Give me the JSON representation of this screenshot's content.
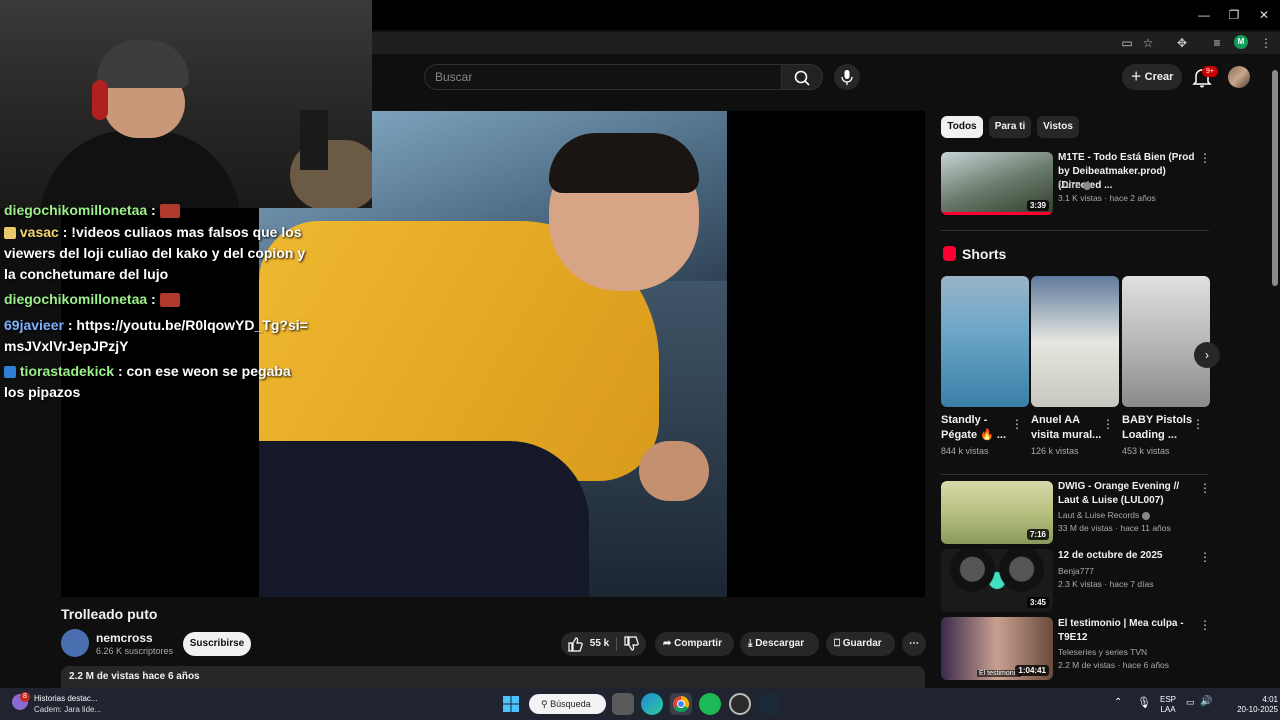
{
  "browser": {
    "window_controls": [
      "—",
      "❐",
      "✕"
    ],
    "omnibox_icons": [
      "cast-icon",
      "star-icon",
      "extensions-icon",
      "media-icon",
      "profile-icon",
      "menu-icon"
    ],
    "profile_initial": "M"
  },
  "header": {
    "search_placeholder": "Buscar",
    "create_label": "Crear",
    "notifications_badge": "9+"
  },
  "chat": [
    {
      "user": "diegochikomillonetaa",
      "sep": " :",
      "text": "",
      "emote": true,
      "user_class": "u-green"
    },
    {
      "user": "vasac",
      "sep": " :",
      "text": " !videos culiaos mas falsos que los viewers del loji culiao del kako y del copion y la conchetumare del lujo",
      "emote": false,
      "user_class": "u-yellow"
    },
    {
      "user": "diegochikomillonetaa",
      "sep": " :",
      "text": "",
      "emote": true,
      "user_class": "u-green"
    },
    {
      "user": "69javieer",
      "sep": " :",
      "text": " https://youtu.be/R0lqowYD_Tg?si=msJVxlVrJepJPzjY",
      "emote": false,
      "user_class": "u-blue"
    },
    {
      "user": "tiorastadekick",
      "sep": " :",
      "text": " con ese weon se pegaba los pipazos",
      "emote": false,
      "user_class": "u-green"
    }
  ],
  "video": {
    "title": "Trolleado puto",
    "channel": "nemcross",
    "subscribers": "6.26 K suscriptores",
    "subscribe_label": "Suscribirse",
    "likes": "55 k",
    "share_label": "Compartir",
    "download_label": "Descargar",
    "save_label": "Guardar",
    "description_meta": "2.2 M de vistas  hace 6 años"
  },
  "sidebar": {
    "chips": [
      "Todos",
      "Para ti",
      "Vistos"
    ],
    "related_top": {
      "title": "M1TE - Todo Está Bien (Prod by Deibeatmaker.prod) (Directed ...",
      "channel": "M1TE",
      "meta": "3.1 K vistas · hace 2 años",
      "duration": "3:39"
    },
    "shorts_heading": "Shorts",
    "shorts": [
      {
        "title": "Standly - Pégate 🔥 ...",
        "views": "844 k vistas"
      },
      {
        "title": "Anuel AA visita mural...",
        "views": "126 k vistas"
      },
      {
        "title": "BABY Pistols Loading ...",
        "views": "453 k vistas"
      }
    ],
    "related": [
      {
        "title": "DWIG - Orange Evening // Laut & Luise (LUL007)",
        "channel": "Laut & Luise Records",
        "meta": "33 M de vistas · hace 11 años",
        "duration": "7:16"
      },
      {
        "title": "12 de octubre de 2025",
        "channel": "Benja777",
        "meta": "2.3 K vistas · hace 7 días",
        "duration": "3:45"
      },
      {
        "title": "El testimonio | Mea culpa - T9E12",
        "channel": "Teleseries y series TVN",
        "meta": "2.2 M de vistas · hace 6 años",
        "duration": "1:04:41",
        "overlay": "El testimonio"
      }
    ]
  },
  "taskbar": {
    "news_title": "Historias destac...",
    "news_sub": "Cadem: Jara lide...",
    "news_badge": "8",
    "search_label": "Búsqueda",
    "lang": "ESP",
    "layout": "LAA",
    "time": "4:01",
    "date": "20-10-2025"
  }
}
